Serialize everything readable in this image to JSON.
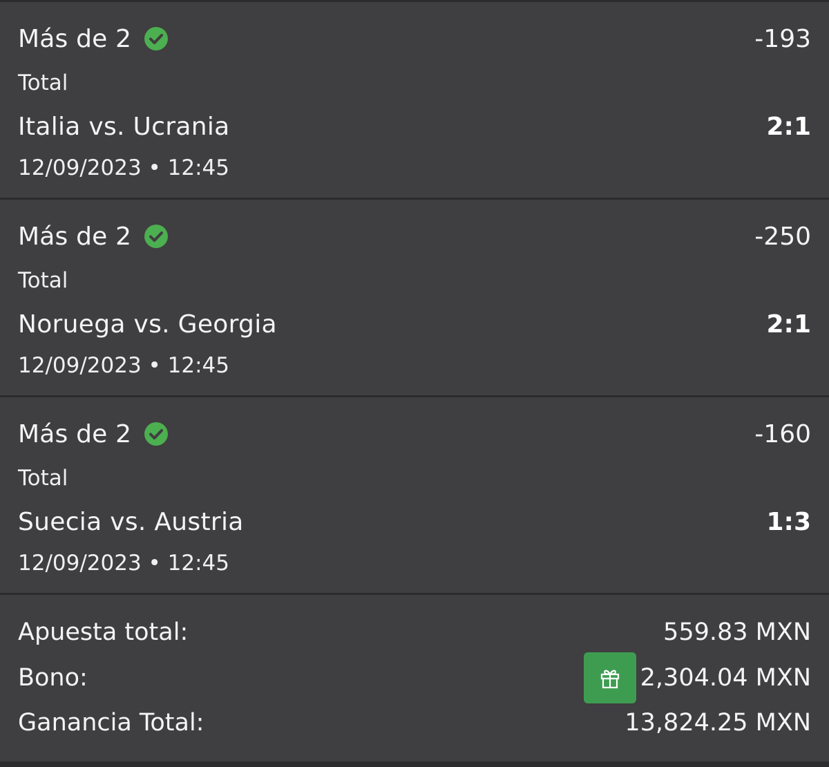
{
  "bets": [
    {
      "market": "Más de 2",
      "odds": "-193",
      "type": "Total",
      "match": "Italia vs. Ucrania",
      "score": "2:1",
      "datetime": "12/09/2023 • 12:45"
    },
    {
      "market": "Más de 2",
      "odds": "-250",
      "type": "Total",
      "match": "Noruega vs. Georgia",
      "score": "2:1",
      "datetime": "12/09/2023 • 12:45"
    },
    {
      "market": "Más de 2",
      "odds": "-160",
      "type": "Total",
      "match": "Suecia vs. Austria",
      "score": "1:3",
      "datetime": "12/09/2023 • 12:45"
    }
  ],
  "summary": {
    "stake_label": "Apuesta total:",
    "stake_value": "559.83 MXN",
    "bonus_label": "Bono:",
    "bonus_value": "2,304.04 MXN",
    "total_label": "Ganancia Total:",
    "total_value": "13,824.25 MXN"
  },
  "icons": {
    "won": "check-circle-icon",
    "bonus": "gift-icon"
  },
  "colors": {
    "background": "#3f3e40",
    "divider": "#2b2a2c",
    "won_green": "#4caf50",
    "badge_green": "#3e9c51",
    "text": "#f4f4f4"
  }
}
